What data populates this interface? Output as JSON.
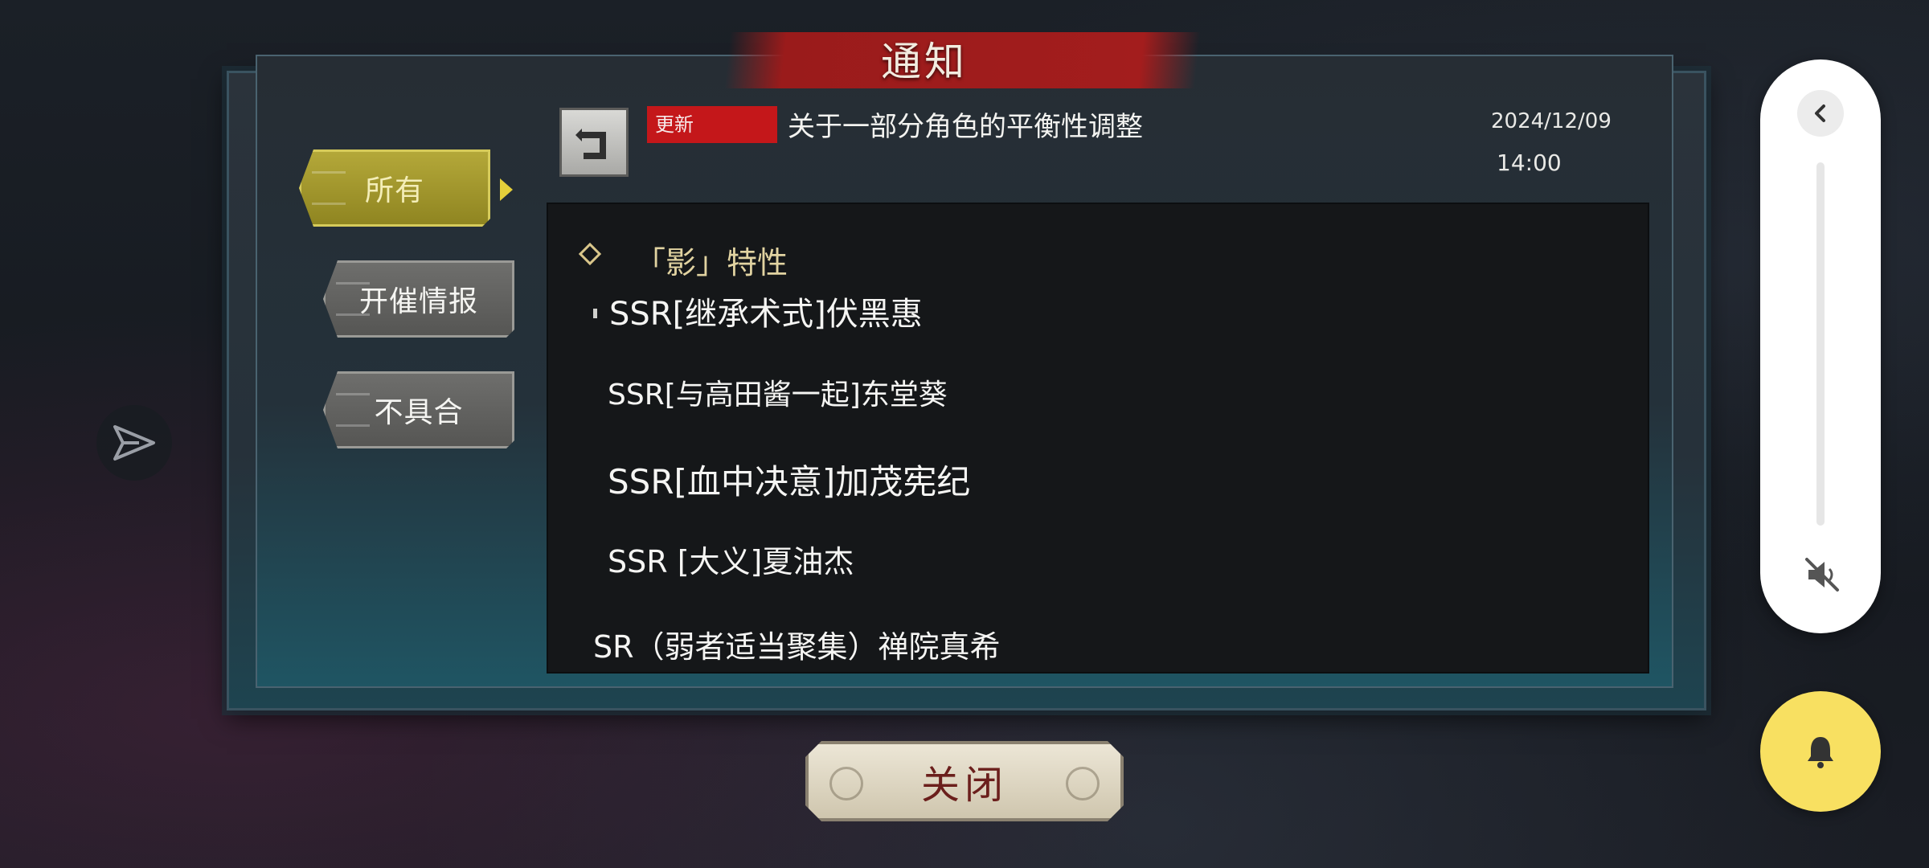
{
  "dialog": {
    "title": "通知"
  },
  "tabs": [
    {
      "label": "所有",
      "selected": true
    },
    {
      "label": "开催情报",
      "selected": false
    },
    {
      "label": "不具合",
      "selected": false
    }
  ],
  "notice": {
    "badge": "更新",
    "title": "关于一部分角色的平衡性调整",
    "date": "2024/12/09",
    "time": "14:00"
  },
  "content": {
    "section_heading": "「影」特性",
    "lines": [
      "SSR[继承术式]伏黑惠",
      "SSR[与高田酱一起]东堂葵",
      "SSR[血中决意]加茂宪纪",
      "SSR [大义]夏油杰",
      "SR（弱者适当聚集）禅院真希"
    ]
  },
  "footer": {
    "close_label": "关闭"
  },
  "icons": {
    "back": "return-arrow-icon",
    "share": "paper-plane-icon",
    "collapse": "chevron-left-icon",
    "mute": "volume-muted-icon",
    "bell": "bell-icon"
  },
  "colors": {
    "accent_tab": "#b5a93a",
    "badge": "#c4171a",
    "bell_button": "#f8e061",
    "close_text": "#6b1f1c"
  }
}
